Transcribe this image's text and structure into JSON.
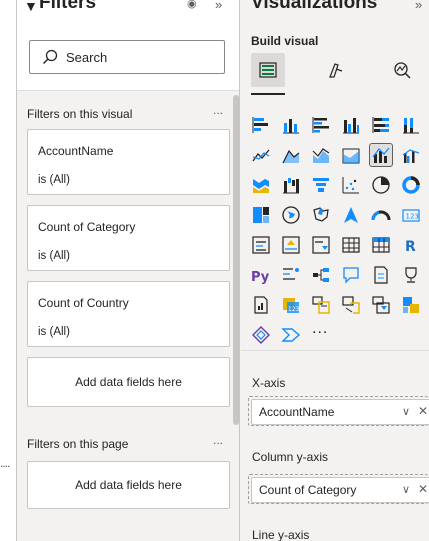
{
  "filters_pane": {
    "title": "Filters",
    "search_placeholder": "Search",
    "visual_section": {
      "title": "Filters on this visual",
      "more": "...",
      "cards": [
        {
          "field": "AccountName",
          "state": "is (All)"
        },
        {
          "field": "Count of Category",
          "state": "is (All)"
        },
        {
          "field": "Count of Country",
          "state": "is (All)"
        }
      ],
      "add_label": "Add data fields here"
    },
    "page_section": {
      "title": "Filters on this page",
      "more": "...",
      "add_label": "Add data fields here"
    },
    "collapsed_dots": "...."
  },
  "viz_pane": {
    "title": "Visualizations",
    "build_label": "Build visual",
    "more_visuals": "...",
    "wells": [
      {
        "label": "X-axis",
        "field": "AccountName"
      },
      {
        "label": "Column y-axis",
        "field": "Count of Category"
      },
      {
        "label": "Line y-axis",
        "field": ""
      }
    ]
  },
  "colors": {
    "pane_bg": "#f3f2f1",
    "accent_blue": "#118dff",
    "accent_yellow": "#e8b500",
    "accent_purple": "#6b3fa0",
    "border": "#c8c6c4"
  }
}
